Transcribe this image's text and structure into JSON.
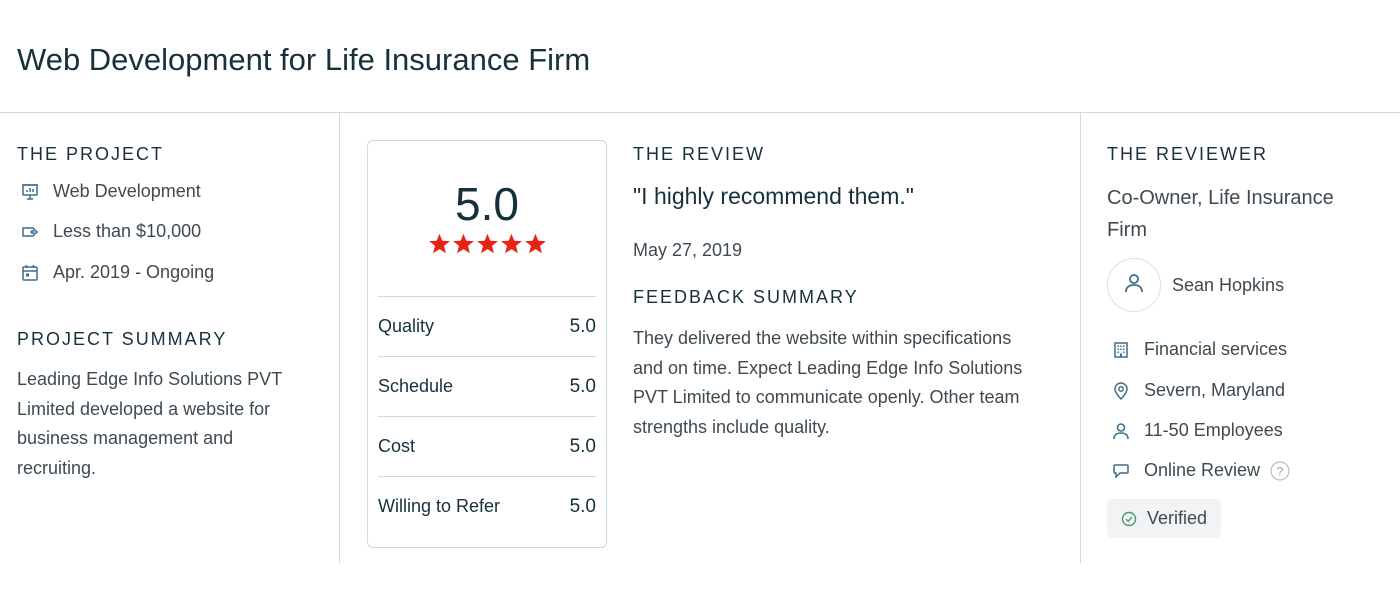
{
  "header": {
    "title": "Web Development for Life Insurance Firm"
  },
  "project": {
    "heading": "THE PROJECT",
    "service": {
      "label": "Web Development",
      "icon": "presentation-board-icon"
    },
    "budget": {
      "label": "Less than $10,000",
      "icon": "price-tag-icon"
    },
    "timeline": {
      "label": "Apr. 2019 - Ongoing",
      "icon": "calendar-icon"
    },
    "summary_heading": "PROJECT SUMMARY",
    "summary_text": "Leading Edge Info Solutions PVT Limited developed a website for business management and recruiting."
  },
  "rating": {
    "overall": "5.0",
    "stars": 5,
    "star_color": "#e62415",
    "rows": [
      {
        "label": "Quality",
        "value": "5.0"
      },
      {
        "label": "Schedule",
        "value": "5.0"
      },
      {
        "label": "Cost",
        "value": "5.0"
      },
      {
        "label": "Willing to Refer",
        "value": "5.0"
      }
    ]
  },
  "review": {
    "heading": "THE REVIEW",
    "quote": "\"I highly recommend them.\"",
    "date": "May 27, 2019",
    "feedback_heading": "FEEDBACK SUMMARY",
    "feedback_lines": [
      "They delivered the website within specifications",
      "and on time. Expect Leading Edge Info Solutions",
      "PVT Limited to communicate openly. Other team",
      "strengths include quality."
    ]
  },
  "reviewer": {
    "heading": "THE REVIEWER",
    "title": "Co-Owner, Life Insurance Firm",
    "name": "Sean Hopkins",
    "industry": {
      "label": "Financial services",
      "icon": "building-icon"
    },
    "location": {
      "label": "Severn, Maryland",
      "icon": "location-pin-icon"
    },
    "company_size": {
      "label": "11-50 Employees",
      "icon": "person-icon"
    },
    "review_type": {
      "label": "Online Review",
      "icon": "chat-bubble-icon"
    },
    "verified_label": "Verified"
  },
  "colors": {
    "text_dark": "#17313b",
    "text_body": "#3e4a52",
    "icon_blue": "#3d6e8a",
    "divider": "#c9dbe3",
    "star_red": "#e62415",
    "verified_green": "#4a9a64"
  }
}
